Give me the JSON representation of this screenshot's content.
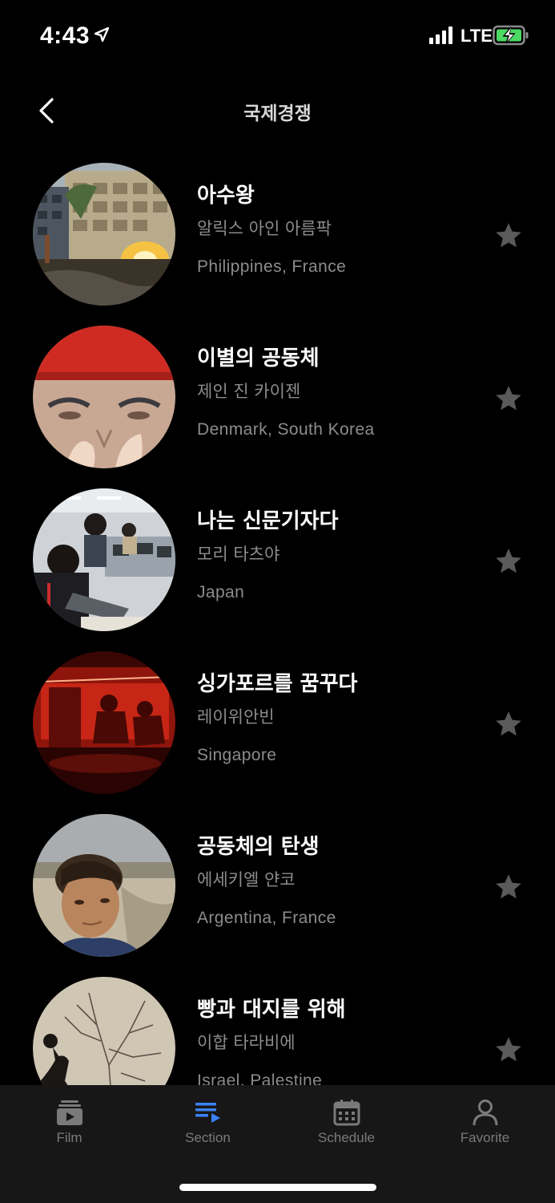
{
  "status_bar": {
    "time": "4:43",
    "network": "LTE",
    "icons": [
      "location-arrow-icon",
      "signal-bars-icon",
      "battery-charging-icon"
    ]
  },
  "header": {
    "title": "국제경쟁",
    "back_icon": "chevron-left-icon"
  },
  "films": [
    {
      "title": "아수왕",
      "director": "알릭스 아인 아름팍",
      "country": "Philippines, France",
      "favorite": false
    },
    {
      "title": "이별의 공동체",
      "director": "제인 진 카이젠",
      "country": "Denmark, South Korea",
      "favorite": false
    },
    {
      "title": "나는 신문기자다",
      "director": "모리 타츠야",
      "country": "Japan",
      "favorite": false
    },
    {
      "title": "싱가포르를 꿈꾸다",
      "director": "레이위안빈",
      "country": "Singapore",
      "favorite": false
    },
    {
      "title": "공동체의 탄생",
      "director": "에세키엘 얀코",
      "country": "Argentina, France",
      "favorite": false
    },
    {
      "title": "빵과 대지를 위해",
      "director": "이합 타라비에",
      "country": "Israel, Palestine",
      "favorite": false
    }
  ],
  "tab_bar": {
    "active": "Section",
    "tabs": [
      {
        "label": "Film",
        "icon": "film-icon"
      },
      {
        "label": "Section",
        "icon": "section-list-icon"
      },
      {
        "label": "Schedule",
        "icon": "calendar-icon"
      },
      {
        "label": "Favorite",
        "icon": "person-icon"
      }
    ]
  },
  "colors": {
    "background": "#000000",
    "secondary_text": "#8c8c8c",
    "star": "#5a5a5a",
    "active_tab": "#3b82f6",
    "tab_bar_bg": "#171717"
  }
}
